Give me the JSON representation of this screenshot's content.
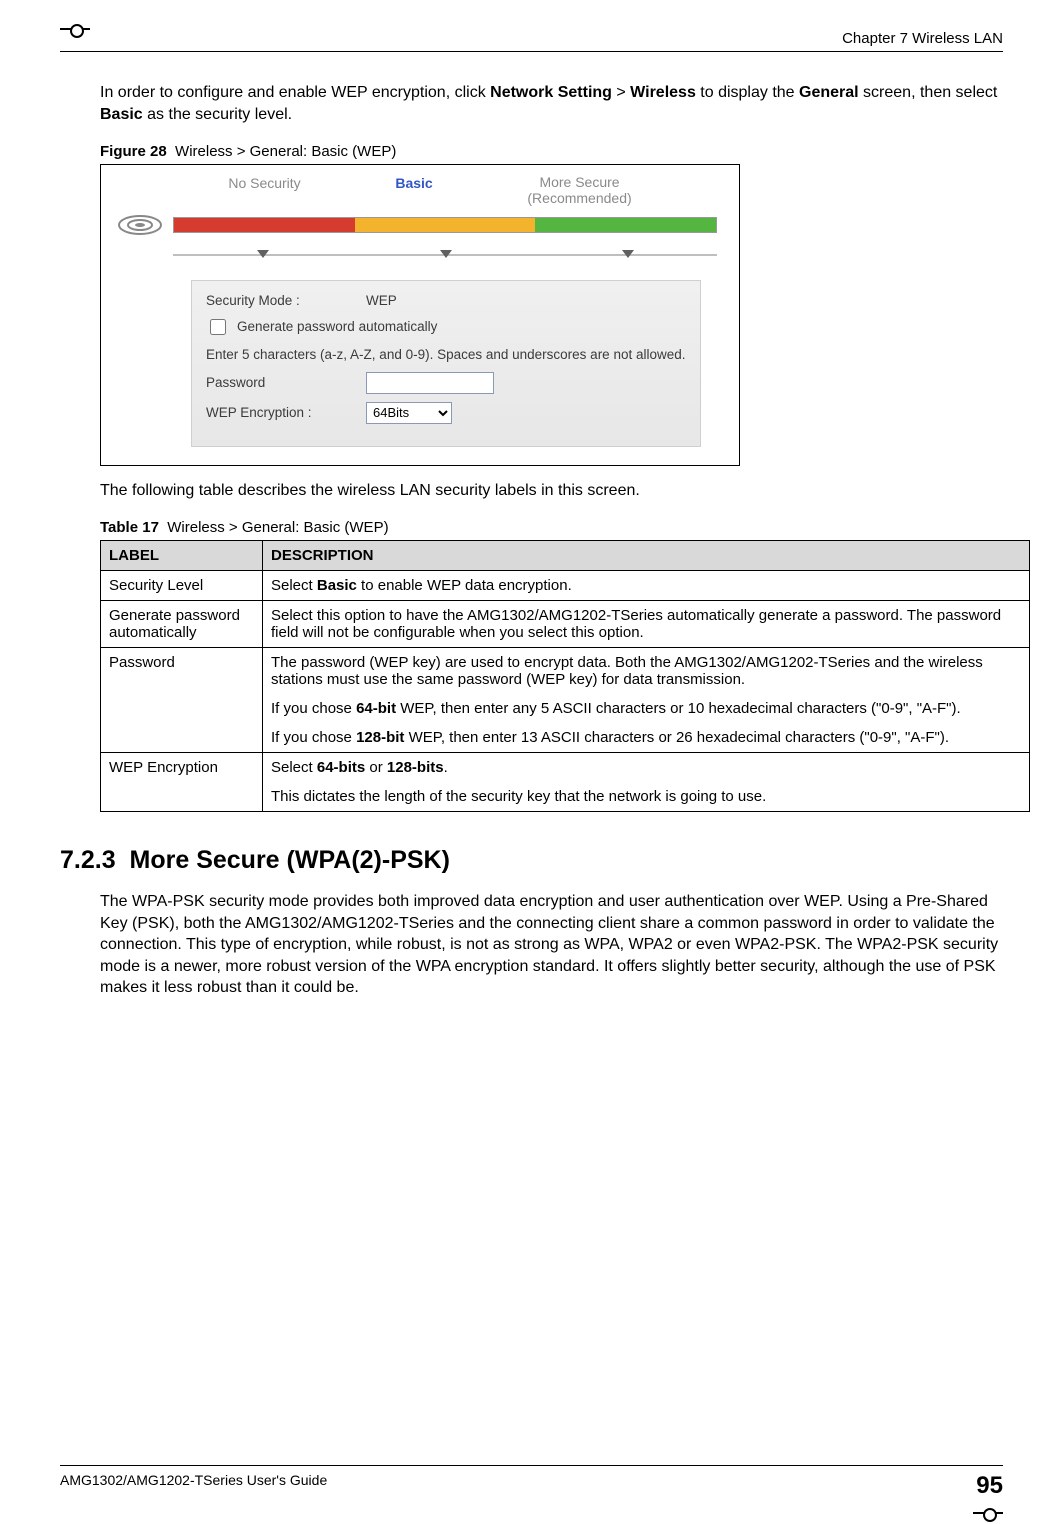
{
  "header": {
    "chapter": "Chapter 7 Wireless LAN"
  },
  "para1": {
    "t1": "In order to configure and enable WEP encryption, click ",
    "b1": "Network Setting",
    "t2": " > ",
    "b2": "Wireless",
    "t3": " to display the ",
    "b3": "General",
    "t4": " screen, then select ",
    "b4": "Basic",
    "t5": " as the security level."
  },
  "figure": {
    "label": "Figure 28",
    "title": "Wireless > General: Basic (WEP)",
    "sec_levels": {
      "no_security": "No Security",
      "basic": "Basic",
      "more1": "More Secure",
      "more2": "(Recommended)"
    },
    "panel": {
      "security_mode_label": "Security Mode :",
      "security_mode_value": "WEP",
      "generate_label": "Generate password automatically",
      "note": "Enter 5 characters (a-z, A-Z, and 0-9). Spaces and underscores are not allowed.",
      "password_label": "Password",
      "password_value": "",
      "wep_enc_label": "WEP Encryption :",
      "wep_enc_value": "64Bits"
    }
  },
  "para2": "The following table describes the wireless LAN security labels in this screen.",
  "table": {
    "label": "Table 17",
    "title": "Wireless > General: Basic (WEP)",
    "head": {
      "c1": "LABEL",
      "c2": "DESCRIPTION"
    },
    "rows": {
      "r1c1": "Security Level",
      "r1c2_t1": "Select ",
      "r1c2_b1": "Basic",
      "r1c2_t2": " to enable WEP data encryption.",
      "r2c1": "Generate password automatically",
      "r2c2": "Select this option to have the AMG1302/AMG1202-TSeries automatically generate a password. The password field will not be configurable when you select this option.",
      "r3c1": "Password",
      "r3c2_p1": "The password (WEP key) are used to encrypt data. Both the AMG1302/AMG1202-TSeries and the wireless stations must use the same password (WEP key) for data transmission.",
      "r3c2_p2_t1": "If you chose ",
      "r3c2_p2_b1": "64-bit",
      "r3c2_p2_t2": " WEP, then enter any 5 ASCII characters or 10 hexadecimal characters (\"0-9\", \"A-F\").",
      "r3c2_p3_t1": "If you chose ",
      "r3c2_p3_b1": "128-bit",
      "r3c2_p3_t2": " WEP, then enter 13 ASCII characters or 26 hexadecimal characters (\"0-9\", \"A-F\").",
      "r4c1": "WEP Encryption",
      "r4c2_p1_t1": "Select ",
      "r4c2_p1_b1": "64-bits",
      "r4c2_p1_t2": " or ",
      "r4c2_p1_b2": "128-bits",
      "r4c2_p1_t3": ".",
      "r4c2_p2": "This dictates the length of the security key that the network is going to use."
    }
  },
  "section": {
    "num": "7.2.3",
    "title": "More Secure (WPA(2)-PSK)"
  },
  "para3": "The WPA-PSK security mode provides both improved data encryption and user authentication over WEP. Using a Pre-Shared Key (PSK), both the AMG1302/AMG1202-TSeries and the connecting client share a common password in order to validate the connection. This type of encryption, while robust, is not as strong as WPA, WPA2 or even WPA2-PSK. The WPA2-PSK security mode is a newer, more robust version of the WPA encryption standard. It offers slightly better security, although the use of PSK makes it less robust than it could be.",
  "footer": {
    "guide": "AMG1302/AMG1202-TSeries User's Guide",
    "page": "95"
  }
}
